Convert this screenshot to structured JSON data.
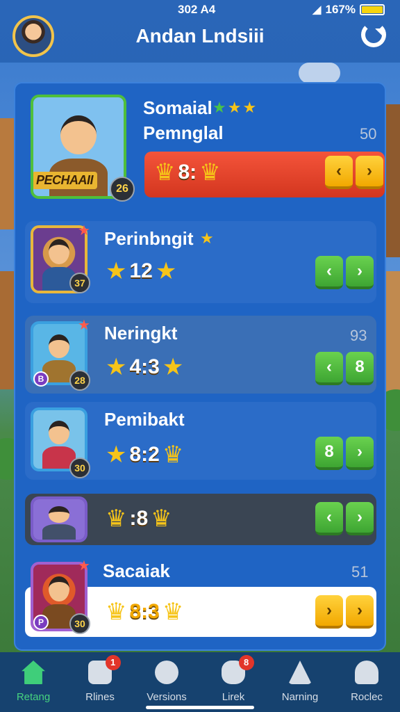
{
  "status_bar": {
    "time": "302 A4",
    "signal": "◢",
    "battery_percent": "167%"
  },
  "header": {
    "title": "Andan Lndsiii",
    "avatar_icon": "player-avatar-icon",
    "refresh_icon": "refresh-icon"
  },
  "rows": [
    {
      "name": "Somaial",
      "subtitle": "Pemnglal",
      "score": "50",
      "stars": "★★★",
      "thumb_banner": "PECHAAII",
      "level": "26",
      "stat": "8:",
      "buttons": [
        "‹",
        "›"
      ]
    },
    {
      "name": "Perinbngit",
      "stars": "★",
      "level": "37",
      "stat": "12",
      "buttons": [
        "‹",
        "›"
      ]
    },
    {
      "name": "Neringkt",
      "score": "93",
      "level": "28",
      "badge": "B",
      "stat": "4:3",
      "buttons": [
        "‹",
        "8"
      ]
    },
    {
      "name": "Pemibakt",
      "level": "30",
      "stat": "8:2",
      "buttons": [
        "8",
        "›"
      ]
    },
    {
      "name": "",
      "stat": ":8",
      "buttons": [
        "‹",
        "›"
      ]
    },
    {
      "name": "Sacaiak",
      "score": "51",
      "level": "30",
      "badge": "P",
      "stat": "8:3",
      "buttons": [
        "›",
        "›"
      ]
    }
  ],
  "nav": [
    {
      "label": "Retang",
      "icon": "home-icon",
      "active": true
    },
    {
      "label": "Rlines",
      "icon": "chat-icon",
      "badge": "1"
    },
    {
      "label": "Versions",
      "icon": "camera-icon"
    },
    {
      "label": "Lirek",
      "icon": "gamepad-icon",
      "badge": "8"
    },
    {
      "label": "Narning",
      "icon": "warning-icon"
    },
    {
      "label": "Roclec",
      "icon": "profile-icon"
    }
  ]
}
